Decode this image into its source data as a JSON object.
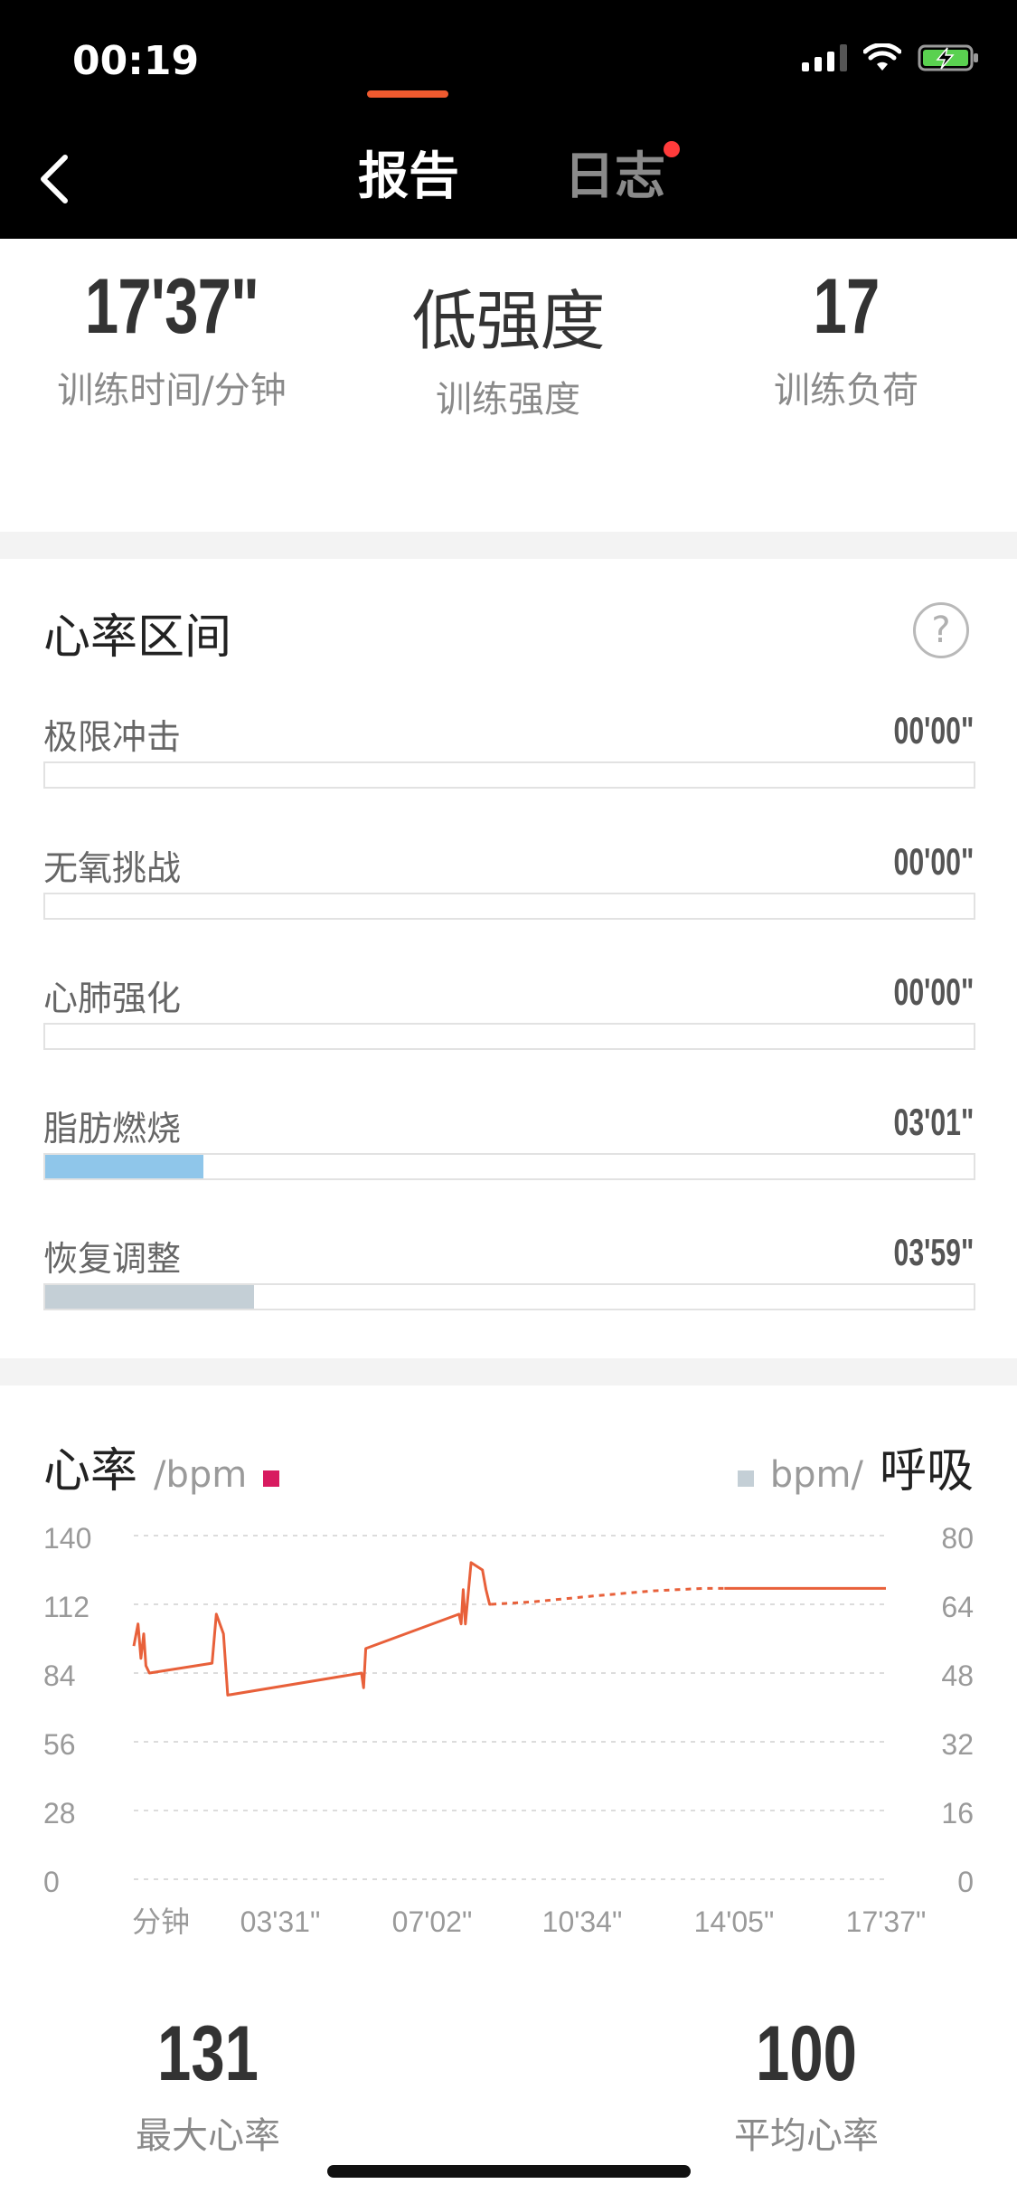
{
  "status_bar": {
    "time": "00:19"
  },
  "header": {
    "tabs": [
      {
        "label": "报告",
        "active": true
      },
      {
        "label": "日志",
        "active": false,
        "badge": true
      }
    ],
    "accent_color": "#ef5a2f"
  },
  "summary": [
    {
      "value": "17'37\"",
      "label": "训练时间/分钟"
    },
    {
      "value": "低强度",
      "label": "训练强度"
    },
    {
      "value": "17",
      "label": "训练负荷"
    }
  ],
  "zones": {
    "title": "心率区间",
    "help_icon": "?",
    "items": [
      {
        "name": "极限冲击",
        "duration": "00'00\"",
        "fraction": 0.0,
        "color": "#8fc6ea"
      },
      {
        "name": "无氧挑战",
        "duration": "00'00\"",
        "fraction": 0.0,
        "color": "#8fc6ea"
      },
      {
        "name": "心肺强化",
        "duration": "00'00\"",
        "fraction": 0.0,
        "color": "#8fc6ea"
      },
      {
        "name": "脂肪燃烧",
        "duration": "03'01\"",
        "fraction": 0.17,
        "color": "#8fc6ea"
      },
      {
        "name": "恢复调整",
        "duration": "03'59\"",
        "fraction": 0.225,
        "color": "#c4cfd6"
      }
    ]
  },
  "chart_header": {
    "left_title": "心率",
    "left_unit": "/bpm",
    "left_color": "#d81b60",
    "right_unit": "bpm/",
    "right_title": "呼吸",
    "right_color": "#c4cfd6"
  },
  "chart_data": {
    "type": "line",
    "x_tick_labels": [
      "分钟",
      "03'31\"",
      "07'02\"",
      "10'34\"",
      "14'05\"",
      "17'37\""
    ],
    "x_range_seconds": [
      0,
      1057
    ],
    "y_left": {
      "ticks": [
        0,
        28,
        56,
        84,
        112,
        140
      ],
      "range": [
        0,
        140
      ]
    },
    "y_right": {
      "ticks": [
        0,
        16,
        32,
        48,
        64,
        80
      ],
      "range": [
        0,
        80
      ]
    },
    "grid": true,
    "series": [
      {
        "color": "#e8603a",
        "style": "solid",
        "points": [
          [
            0,
            95
          ],
          [
            6,
            104
          ],
          [
            10,
            90
          ],
          [
            14,
            100
          ],
          [
            17,
            87
          ],
          [
            22,
            84
          ],
          [
            110,
            88
          ],
          [
            116,
            108
          ],
          [
            126,
            100
          ],
          [
            132,
            75
          ],
          [
            320,
            84
          ],
          [
            323,
            78
          ],
          [
            326,
            94
          ],
          [
            457,
            108
          ],
          [
            460,
            104
          ],
          [
            463,
            118
          ],
          [
            466,
            104
          ],
          [
            474,
            129
          ],
          [
            490,
            126
          ],
          [
            495,
            118
          ],
          [
            500,
            112
          ],
          [
            502,
            112
          ]
        ]
      },
      {
        "color": "#e8603a",
        "style": "dashed",
        "points": [
          [
            502,
            112
          ],
          [
            560,
            113
          ],
          [
            650,
            115.5
          ],
          [
            730,
            117.5
          ],
          [
            800,
            118.5
          ],
          [
            830,
            118.5
          ]
        ]
      },
      {
        "color": "#e8603a",
        "style": "solid",
        "points": [
          [
            830,
            118.5
          ],
          [
            1057,
            118.5
          ]
        ]
      }
    ]
  },
  "bottom_stats": [
    {
      "value": "131",
      "label": "最大心率"
    },
    {
      "value": "100",
      "label": "平均心率"
    }
  ]
}
